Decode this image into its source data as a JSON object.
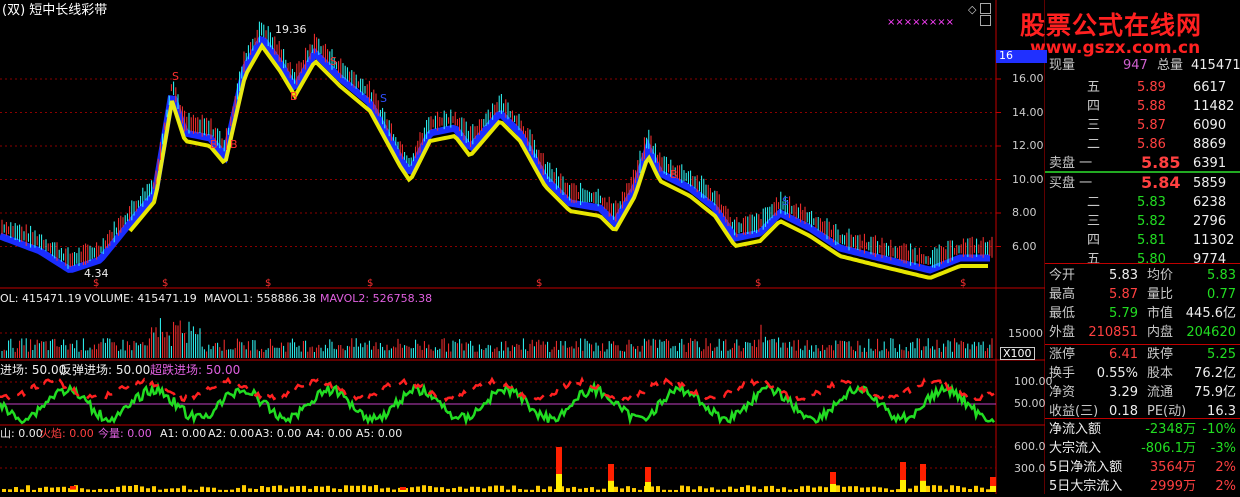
{
  "title": "(双) 短中长线彩带",
  "watermark": {
    "cn": "股票公式在线网",
    "url": "www.gszx.com.cn"
  },
  "price_chart": {
    "high_label": "19.36",
    "low_label": "4.34",
    "y_ticks": [
      "16.00",
      "14.00",
      "12.00",
      "10.00",
      "8.00",
      "6.00"
    ],
    "top_badge": "16",
    "signals": [
      {
        "text": "S",
        "color": "#ff3030"
      },
      {
        "text": "B",
        "color": "#ff3030"
      },
      {
        "text": "S",
        "color": "#3050ff"
      },
      {
        "text": "S",
        "color": "#3050ff"
      },
      {
        "text": "B",
        "color": "#ff3030"
      },
      {
        "text": "B",
        "color": "#ff3030"
      },
      {
        "text": "S",
        "color": "#ff3030"
      },
      {
        "text": "B",
        "color": "#ff3030"
      }
    ],
    "dollar_marks": [
      "$",
      "$",
      "$",
      "$",
      "$",
      "$",
      "$",
      "$"
    ],
    "top_markers": "××××××××"
  },
  "volume_panel": {
    "label_vol": "OL: 415471.19",
    "label_volume": "VOLUME: 415471.19",
    "label_mavol1": "MAVOL1: 558886.38",
    "label_mavol2": "MAVOL2: 526758.38",
    "tick": "15000",
    "scale": "X100"
  },
  "entry_panel": {
    "label1": "进场: 50.00",
    "label2": "反弹进场: 50.00",
    "label3": "超跌进场: 50.00",
    "tick_high": "100.00",
    "tick_low": "50.00"
  },
  "fire_panel": {
    "label0": "山: 0.00",
    "label1": "火焰: 0.00",
    "label2": "今量: 0.00",
    "label3": "A1: 0.00",
    "label4": "A2: 0.00",
    "label5": "A3: 0.00",
    "label6": "A4: 0.00",
    "label7": "A5: 0.00",
    "tick_high": "600.0",
    "tick_low": "300.0"
  },
  "quote": {
    "now_label": "现量",
    "now_value": "947",
    "total_label": "总量",
    "total_value": "415471",
    "asks": [
      {
        "label": "五",
        "price": "5.89",
        "vol": "6617"
      },
      {
        "label": "四",
        "price": "5.88",
        "vol": "11482"
      },
      {
        "label": "三",
        "price": "5.87",
        "vol": "6090"
      },
      {
        "label": "二",
        "price": "5.86",
        "vol": "8869"
      },
      {
        "label": "卖盘 一",
        "price": "5.85",
        "vol": "6391"
      }
    ],
    "bids": [
      {
        "label": "买盘 一",
        "price": "5.84",
        "vol": "5859"
      },
      {
        "label": "二",
        "price": "5.83",
        "vol": "6238"
      },
      {
        "label": "三",
        "price": "5.82",
        "vol": "2796"
      },
      {
        "label": "四",
        "price": "5.81",
        "vol": "11302"
      },
      {
        "label": "五",
        "price": "5.80",
        "vol": "9774"
      }
    ],
    "stats": [
      {
        "l1": "今开",
        "v1": "5.83",
        "l2": "均价",
        "v2": "5.83"
      },
      {
        "l1": "最高",
        "v1": "5.87",
        "l2": "量比",
        "v2": "0.77"
      },
      {
        "l1": "最低",
        "v1": "5.79",
        "l2": "市值",
        "v2": "445.6亿"
      },
      {
        "l1": "外盘",
        "v1": "210851",
        "l2": "内盘",
        "v2": "204620"
      },
      {
        "l1": "涨停",
        "v1": "6.41",
        "l2": "跌停",
        "v2": "5.25"
      },
      {
        "l1": "换手",
        "v1": "0.55%",
        "l2": "股本",
        "v2": "76.2亿"
      },
      {
        "l1": "净资",
        "v1": "3.29",
        "l2": "流通",
        "v2": "75.9亿"
      },
      {
        "l1": "收益(三)",
        "v1": "0.18",
        "l2": "PE(动)",
        "v2": "16.3"
      }
    ],
    "flows": [
      {
        "label": "净流入额",
        "value": "-2348万",
        "pct": "-10%"
      },
      {
        "label": "大宗流入",
        "value": "-806.1万",
        "pct": "-3%"
      },
      {
        "label": "5日净流入额",
        "value": "3564万",
        "pct": "2%"
      },
      {
        "label": "5日大宗流入",
        "value": "2999万",
        "pct": "2%"
      }
    ]
  },
  "colors": {
    "grid": "#8b0000",
    "up": "#ff3030",
    "down": "#30ffff",
    "ribbon_blue": "#1a2dff",
    "ribbon_yellow": "#ffff00"
  }
}
